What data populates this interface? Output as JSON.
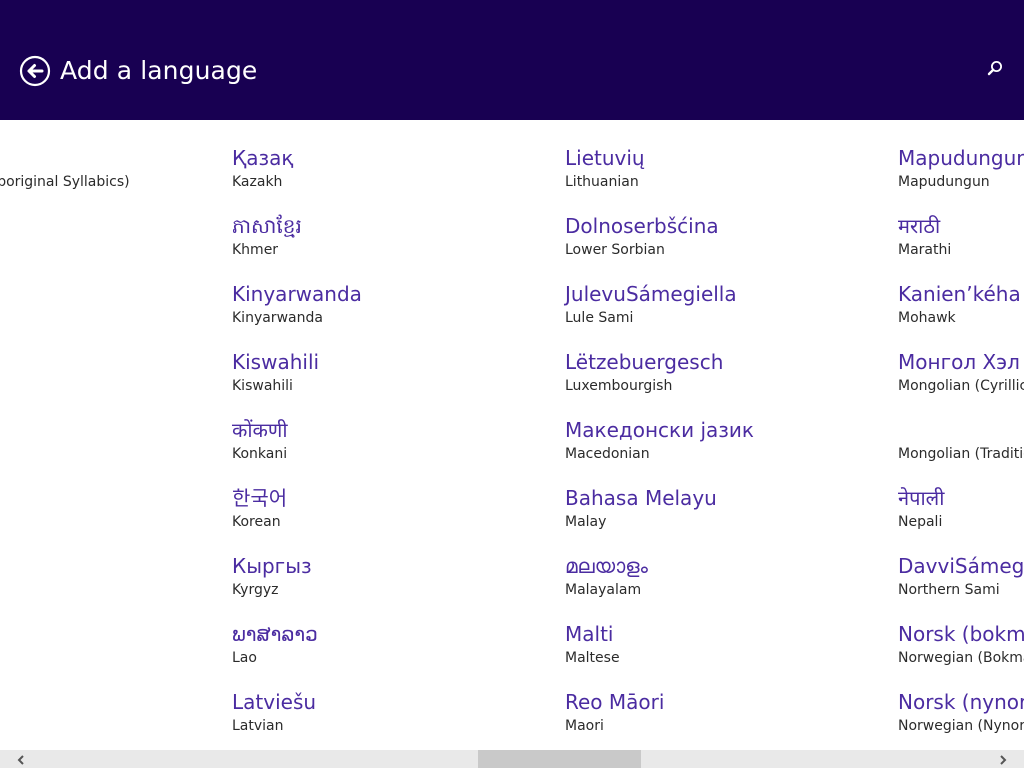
{
  "header": {
    "title": "Add a language",
    "back_icon": "back-arrow-circle-icon",
    "search_icon": "search-icon",
    "background_color": "#180052"
  },
  "columns": [
    {
      "items": [
        {
          "native": "",
          "english": "Inuktitut (Canadian Aboriginal Syllabics)"
        }
      ]
    },
    {
      "items": [
        {
          "native": "Қазақ",
          "english": "Kazakh"
        },
        {
          "native": "ភាសាខ្មែរ",
          "english": "Khmer"
        },
        {
          "native": "Kinyarwanda",
          "english": "Kinyarwanda"
        },
        {
          "native": "Kiswahili",
          "english": "Kiswahili"
        },
        {
          "native": "कोंकणी",
          "english": "Konkani"
        },
        {
          "native": "한국어",
          "english": "Korean"
        },
        {
          "native": "Кыргыз",
          "english": "Kyrgyz"
        },
        {
          "native": "ພາສາລາວ",
          "english": "Lao"
        },
        {
          "native": "Latviešu",
          "english": "Latvian"
        }
      ]
    },
    {
      "items": [
        {
          "native": "Lietuvių",
          "english": "Lithuanian"
        },
        {
          "native": "Dolnoserbšćina",
          "english": "Lower Sorbian"
        },
        {
          "native": "JulevuSámegiella",
          "english": "Lule Sami"
        },
        {
          "native": "Lëtzebuergesch",
          "english": "Luxembourgish"
        },
        {
          "native": "Македонски јазик",
          "english": "Macedonian"
        },
        {
          "native": "Bahasa Melayu",
          "english": "Malay"
        },
        {
          "native": "മലയാളം",
          "english": "Malayalam"
        },
        {
          "native": "Malti",
          "english": "Maltese"
        },
        {
          "native": "Reo Māori",
          "english": "Maori"
        }
      ]
    },
    {
      "items": [
        {
          "native": "Mapudungun",
          "english": "Mapudungun"
        },
        {
          "native": "मराठी",
          "english": "Marathi"
        },
        {
          "native": "Kanien’kéha",
          "english": "Mohawk"
        },
        {
          "native": "Монгол Хэл",
          "english": "Mongolian (Cyrillic)"
        },
        {
          "native": "",
          "english": "Mongolian (Traditional Mongolian)"
        },
        {
          "native": "नेपाली",
          "english": "Nepali"
        },
        {
          "native": "DavviSámegiella",
          "english": "Northern Sami"
        },
        {
          "native": "Norsk (bokmål)",
          "english": "Norwegian (Bokmål)"
        },
        {
          "native": "Norsk (nynorsk)",
          "english": "Norwegian (Nynorsk)"
        }
      ]
    }
  ],
  "scrollbar": {
    "left_icon": "chevron-left-icon",
    "right_icon": "chevron-right-icon",
    "track_color": "#e9e9e9",
    "thumb_color": "#c9c9c9"
  },
  "colors": {
    "accent": "#4b2ca1",
    "secondary_text": "#2b2b2b"
  }
}
